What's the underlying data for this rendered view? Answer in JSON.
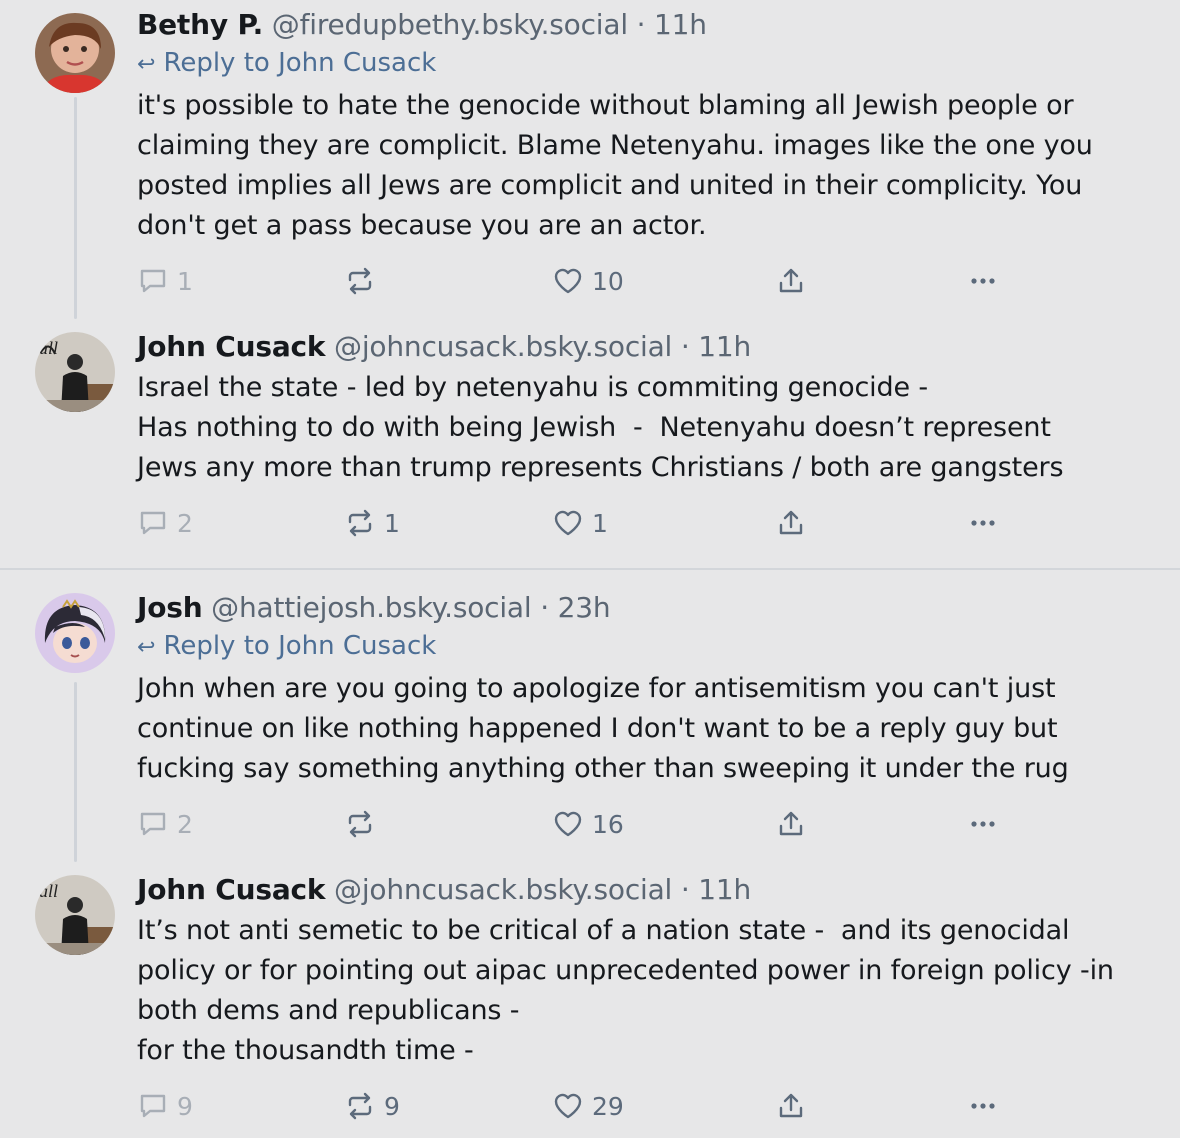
{
  "posts": [
    {
      "author": "Bethy P.",
      "handle": "@firedupbethy.bsky.social",
      "time": "11h",
      "reply_to": "Reply to John Cusack",
      "text": "it's possible to hate the genocide without blaming all Jewish people or\nclaiming they are complicit. Blame Netenyahu. images like the one you\nposted implies all Jews are complicit and united in their complicity. You\ndon't get a pass because you are an actor.",
      "replies": "1",
      "reposts": "",
      "likes": "10"
    },
    {
      "author": "John Cusack",
      "handle": "@johncusack.bsky.social",
      "time": "11h",
      "text": "Israel the state - led by netenyahu is commiting genocide -\nHas nothing to do with being Jewish  -  Netenyahu doesn’t represent\nJews any more than trump represents Christians / both are gangsters",
      "replies": "2",
      "reposts": "1",
      "likes": "1"
    },
    {
      "author": "Josh",
      "handle": "@hattiejosh.bsky.social",
      "time": "23h",
      "reply_to": "Reply to John Cusack",
      "text": "John when are you going to apologize for antisemitism you can't just\ncontinue on like nothing happened I don't want to be a reply guy but\nfucking say something anything other than sweeping it under the rug",
      "replies": "2",
      "reposts": "",
      "likes": "16"
    },
    {
      "author": "John Cusack",
      "handle": "@johncusack.bsky.social",
      "time": "11h",
      "text": "It’s not anti semetic to be critical of a nation state -  and its genocidal\npolicy or for pointing out aipac unprecedented power in foreign policy -in\nboth dems and republicans -\nfor the thousandth time -",
      "replies": "9",
      "reposts": "9",
      "likes": "29"
    }
  ],
  "separator": "·",
  "reply_arrow": "↩",
  "colors": {
    "accent": "#4c6e95",
    "muted": "#5c6a7b",
    "background": "#e7e7e8"
  }
}
